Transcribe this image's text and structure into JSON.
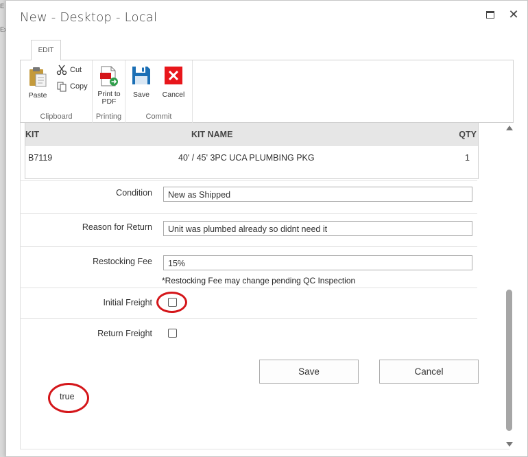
{
  "dialog": {
    "title": "New - Desktop - Local",
    "maximize_icon": "maximize-icon",
    "close_glyph": "✕"
  },
  "background": {
    "text_1": "E",
    "text_2": "Ex"
  },
  "ribbon": {
    "tab_label": "EDIT",
    "groups": {
      "clipboard": {
        "label": "Clipboard",
        "paste": "Paste",
        "cut": "Cut",
        "copy": "Copy"
      },
      "printing": {
        "label": "Printing",
        "print_line1": "Print to",
        "print_line2": "PDF"
      },
      "commit": {
        "label": "Commit",
        "save": "Save",
        "cancel": "Cancel"
      }
    }
  },
  "kit_table": {
    "headers": {
      "kit": "KIT",
      "kit_name": "KIT NAME",
      "qty": "QTY"
    },
    "rows": [
      {
        "kit": "B7119",
        "kit_name": "40' / 45' 3PC UCA PLUMBING PKG",
        "qty": "1"
      }
    ]
  },
  "form": {
    "condition": {
      "label": "Condition",
      "value": "New as Shipped"
    },
    "reason": {
      "label": "Reason for Return",
      "value": "Unit was plumbed already so didnt need it"
    },
    "restocking": {
      "label": "Restocking Fee",
      "value": "15%",
      "note": "*Restocking Fee may change pending QC Inspection"
    },
    "initial_freight": {
      "label": "Initial Freight",
      "checked": false
    },
    "return_freight": {
      "label": "Return Freight",
      "checked": false
    },
    "save_button": "Save",
    "cancel_button": "Cancel",
    "output_text": "true"
  },
  "annotation_color": "#d4161a"
}
